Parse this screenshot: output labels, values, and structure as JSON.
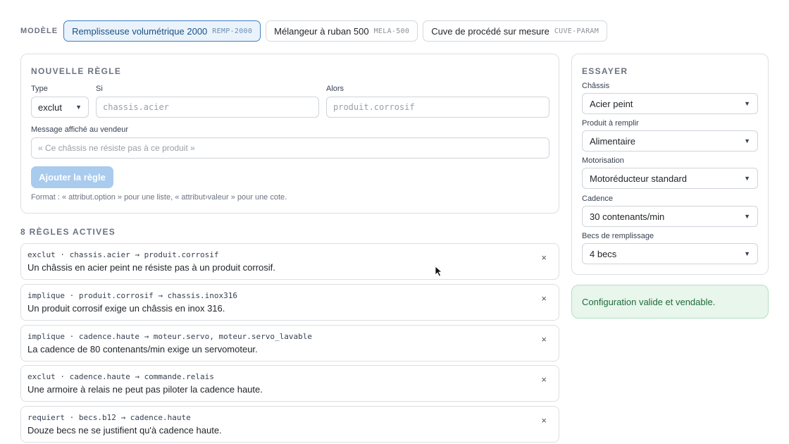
{
  "models": {
    "label": "MODÈLE",
    "items": [
      {
        "name": "Remplisseuse volumétrique 2000",
        "code": "REMP-2000",
        "active": true
      },
      {
        "name": "Mélangeur à ruban 500",
        "code": "MELA-500",
        "active": false
      },
      {
        "name": "Cuve de procédé sur mesure",
        "code": "CUVE-PARAM",
        "active": false
      }
    ]
  },
  "new_rule": {
    "title": "NOUVELLE RÈGLE",
    "type_label": "Type",
    "type_value": "exclut",
    "if_label": "Si",
    "if_placeholder": "chassis.acier",
    "then_label": "Alors",
    "then_placeholder": "produit.corrosif",
    "message_label": "Message affiché au vendeur",
    "message_placeholder": "« Ce châssis ne résiste pas à ce produit »",
    "add_button": "Ajouter la règle",
    "hint": "Format : « attribut.option » pour une liste, « attribut›valeur » pour une cote."
  },
  "active_rules": {
    "title": "8 RÈGLES ACTIVES",
    "items": [
      {
        "code": "exclut · chassis.acier → produit.corrosif",
        "message": "Un châssis en acier peint ne résiste pas à un produit corrosif."
      },
      {
        "code": "implique · produit.corrosif → chassis.inox316",
        "message": "Un produit corrosif exige un châssis en inox 316."
      },
      {
        "code": "implique · cadence.haute → moteur.servo, moteur.servo_lavable",
        "message": "La cadence de 80 contenants/min exige un servomoteur."
      },
      {
        "code": "exclut · cadence.haute → commande.relais",
        "message": "Une armoire à relais ne peut pas piloter la cadence haute."
      },
      {
        "code": "requiert · becs.b12 → cadence.haute",
        "message": "Douze becs ne se justifient qu'à cadence haute."
      }
    ],
    "remove_glyph": "×"
  },
  "try_panel": {
    "title": "ESSAYER",
    "fields": [
      {
        "label": "Châssis",
        "value": "Acier peint"
      },
      {
        "label": "Produit à remplir",
        "value": "Alimentaire"
      },
      {
        "label": "Motorisation",
        "value": "Motoréducteur standard"
      },
      {
        "label": "Cadence",
        "value": "30 contenants/min"
      },
      {
        "label": "Becs de remplissage",
        "value": "4 becs"
      }
    ]
  },
  "status": {
    "text": "Configuration valide et vendable.",
    "color": "#1f6b3a"
  },
  "colors": {
    "accent": "#3d80c4",
    "button_disabled": "#a9cbee",
    "status_bg": "#e8f6ec"
  }
}
